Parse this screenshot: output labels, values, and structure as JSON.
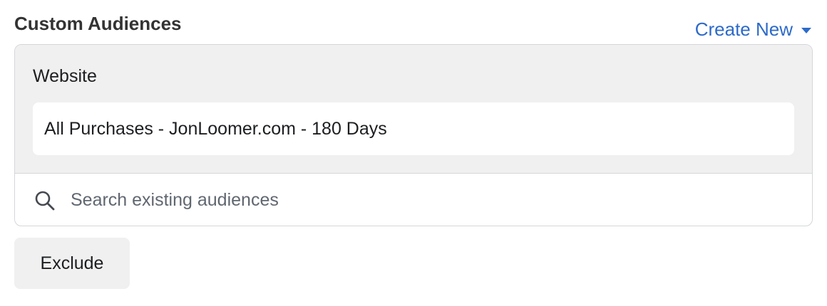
{
  "section": {
    "title": "Custom Audiences",
    "create_new_label": "Create New"
  },
  "selected": {
    "group_label": "Website",
    "items": [
      {
        "label": "All Purchases - JonLoomer.com - 180 Days"
      }
    ]
  },
  "search": {
    "placeholder": "Search existing audiences",
    "value": ""
  },
  "actions": {
    "exclude_label": "Exclude"
  },
  "colors": {
    "link": "#2d6ac9",
    "panel_bg": "#f0f0f0",
    "border": "#d4d6d9"
  },
  "icons": {
    "search": "search-icon",
    "create_new_caret": "caret-down-icon"
  }
}
